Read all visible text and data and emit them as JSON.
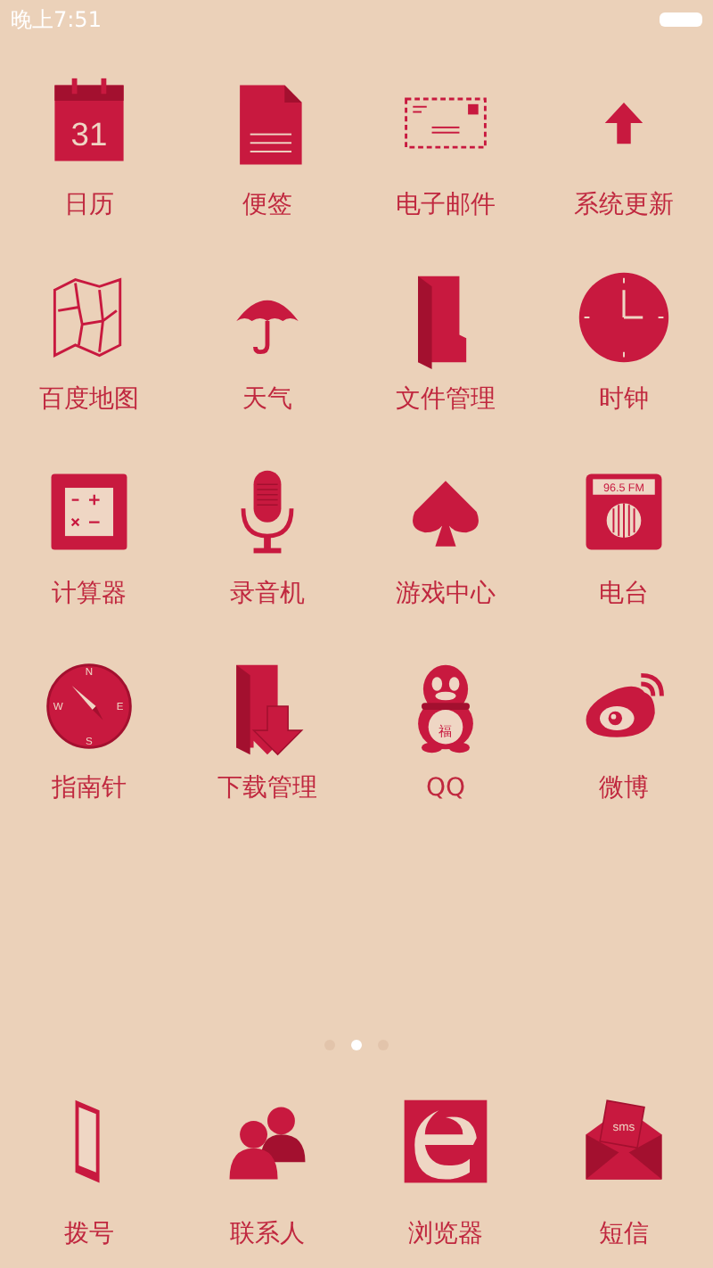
{
  "status_bar": {
    "time": "晚上7:51"
  },
  "apps": [
    {
      "label": "日历",
      "kind": "calendar",
      "icon_text": [
        "31"
      ]
    },
    {
      "label": "便签",
      "kind": "note"
    },
    {
      "label": "电子邮件",
      "kind": "mail"
    },
    {
      "label": "系统更新",
      "kind": "update"
    },
    {
      "label": "百度地图",
      "kind": "map"
    },
    {
      "label": "天气",
      "kind": "umbrella"
    },
    {
      "label": "文件管理",
      "kind": "folder"
    },
    {
      "label": "时钟",
      "kind": "clock"
    },
    {
      "label": "计算器",
      "kind": "calculator"
    },
    {
      "label": "录音机",
      "kind": "mic"
    },
    {
      "label": "游戏中心",
      "kind": "spade"
    },
    {
      "label": "电台",
      "kind": "radio",
      "icon_text": [
        "96.5 FM"
      ]
    },
    {
      "label": "指南针",
      "kind": "compass",
      "icon_text": [
        "N",
        "E",
        "S",
        "W"
      ]
    },
    {
      "label": "下载管理",
      "kind": "download"
    },
    {
      "label": "QQ",
      "kind": "penguin",
      "icon_text": [
        "福"
      ]
    },
    {
      "label": "微博",
      "kind": "weibo"
    }
  ],
  "page_dots": [
    {
      "selected": false
    },
    {
      "selected": true
    },
    {
      "selected": false
    }
  ],
  "dock": [
    {
      "label": "拨号",
      "kind": "phone"
    },
    {
      "label": "联系人",
      "kind": "contacts"
    },
    {
      "label": "浏览器",
      "kind": "browser"
    },
    {
      "label": "短信",
      "kind": "sms",
      "icon_text": [
        "sms"
      ]
    }
  ]
}
